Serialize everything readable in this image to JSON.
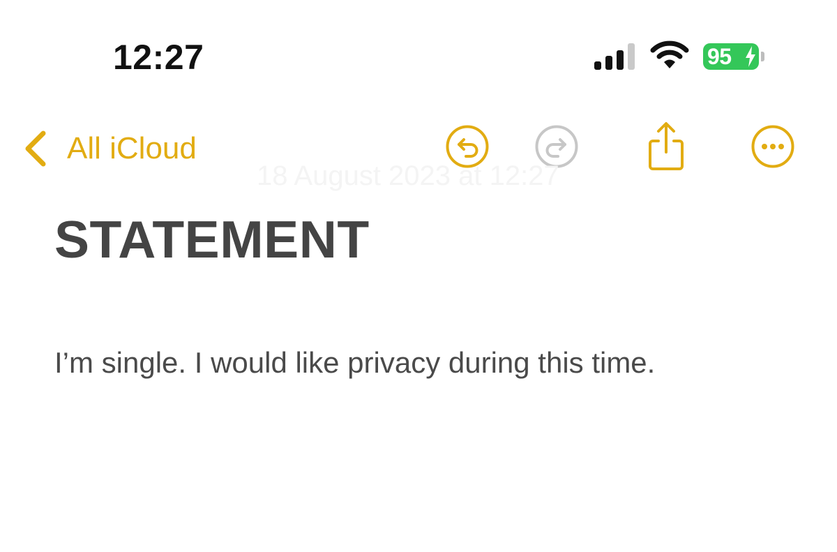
{
  "status_bar": {
    "time": "12:27",
    "battery_percent": "95",
    "battery_charging": true,
    "signal_bars_active": 3,
    "signal_bars_total": 4,
    "icons": [
      "cellular-signal-icon",
      "wifi-icon",
      "battery-icon",
      "charging-bolt-icon"
    ]
  },
  "nav": {
    "back_label": "All iCloud",
    "icons": [
      "chevron-left-icon",
      "undo-icon",
      "redo-icon",
      "share-icon",
      "more-icon"
    ],
    "redo_enabled": false
  },
  "note": {
    "date": "18 August 2023 at 12:27",
    "title": "STATEMENT",
    "body": "I’m single. I would like privacy during this time."
  },
  "colors": {
    "accent": "#e2ac12",
    "disabled": "#c7c7c7",
    "battery": "#34c759",
    "title_text": "#444444",
    "body_text": "#4a4a4a",
    "background": "#ffffff"
  }
}
